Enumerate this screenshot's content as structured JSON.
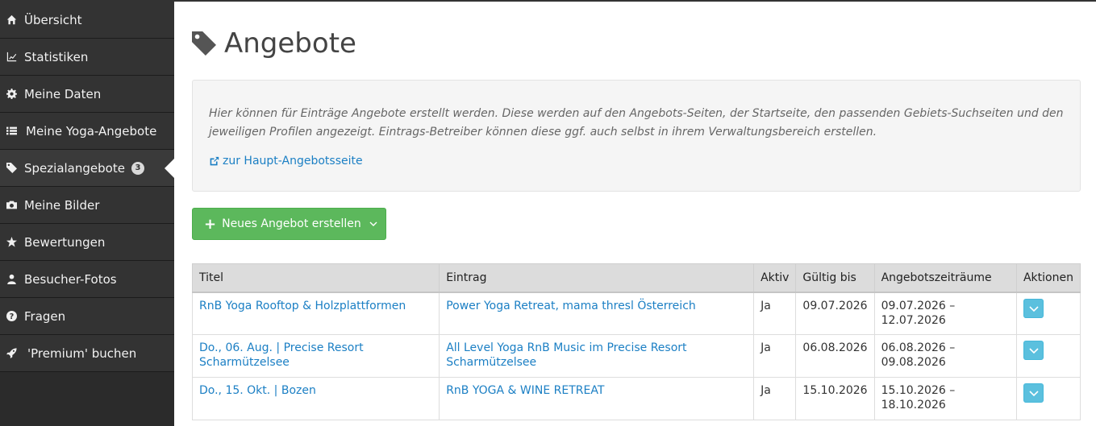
{
  "sidebar": {
    "items": [
      {
        "label": "Übersicht",
        "icon": "home-icon"
      },
      {
        "label": "Statistiken",
        "icon": "chart-icon"
      },
      {
        "label": "Meine Daten",
        "icon": "gear-icon"
      },
      {
        "label": "Meine Yoga-Angebote",
        "icon": "list-icon"
      },
      {
        "label": "Spezialangebote",
        "icon": "tag-icon",
        "badge": "3"
      },
      {
        "label": "Meine Bilder",
        "icon": "camera-icon"
      },
      {
        "label": "Bewertungen",
        "icon": "star-icon"
      },
      {
        "label": "Besucher-Fotos",
        "icon": "user-icon"
      },
      {
        "label": "Fragen",
        "icon": "question-icon"
      },
      {
        "label": "'Premium' buchen",
        "icon": "rocket-icon"
      }
    ]
  },
  "page": {
    "title": "Angebote",
    "info_text": "Hier können für Einträge Angebote erstellt werden. Diese werden auf den Angebots-Seiten, der Startseite, den passenden Gebiets-Suchseiten und den jeweiligen Profilen angezeigt. Eintrags-Betreiber können diese ggf. auch selbst in ihrem Verwaltungsbereich erstellen.",
    "info_link": "zur Haupt-Angebotsseite",
    "new_button": "Neues Angebot erstellen"
  },
  "table": {
    "headers": [
      "Titel",
      "Eintrag",
      "Aktiv",
      "Gültig bis",
      "Angebotszeiträume",
      "Aktionen"
    ],
    "rows": [
      {
        "titel": "RnB Yoga Rooftop & Holzplattformen",
        "eintrag": "Power Yoga Retreat, mama thresl Österreich",
        "aktiv": "Ja",
        "gueltig": "09.07.2026",
        "zeitraum": "09.07.2026 – 12.07.2026"
      },
      {
        "titel": "Do., 06. Aug. | Precise Resort Scharmützelsee",
        "eintrag": "All Level Yoga RnB Music im Precise Resort Scharmützelsee",
        "aktiv": "Ja",
        "gueltig": "06.08.2026",
        "zeitraum": "06.08.2026 – 09.08.2026"
      },
      {
        "titel": "Do., 15. Okt. | Bozen",
        "eintrag": "RnB YOGA & WINE RETREAT",
        "aktiv": "Ja",
        "gueltig": "15.10.2026",
        "zeitraum": "15.10.2026 – 18.10.2026"
      }
    ]
  },
  "colors": {
    "sidebar": "#333333",
    "success": "#5cb85c",
    "info": "#5bc0de",
    "link": "#1b7fc4"
  }
}
